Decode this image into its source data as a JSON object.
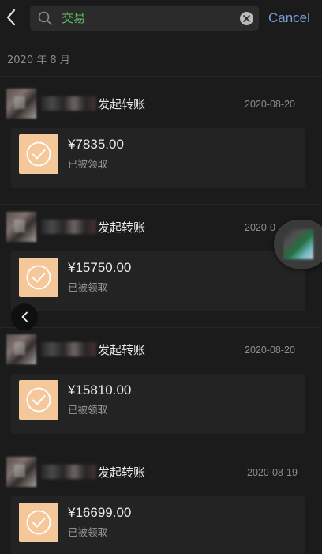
{
  "search": {
    "query": "交易",
    "cancel_label": "Cancel"
  },
  "section": {
    "month_label": "2020 年 8 月"
  },
  "records": [
    {
      "title": "发起转账",
      "date": "2020-08-20",
      "amount": "¥7835.00",
      "status": "已被领取"
    },
    {
      "title": "发起转账",
      "date": "2020-0",
      "amount": "¥15750.00",
      "status": "已被领取"
    },
    {
      "title": "发起转账",
      "date": "2020-08-20",
      "amount": "¥15810.00",
      "status": "已被领取"
    },
    {
      "title": "发起转账",
      "date": "2020-08-19",
      "amount": "¥16699.00",
      "status": "已被领取"
    }
  ],
  "colors": {
    "background": "#1b1b1b",
    "search_text": "#5fbf5f",
    "cancel": "#7a9ed6",
    "transfer_icon_bg": "#f5c89b"
  },
  "icons": {
    "back": "chevron-left-icon",
    "search": "search-icon",
    "clear": "clear-icon",
    "received": "check-circle-icon"
  }
}
